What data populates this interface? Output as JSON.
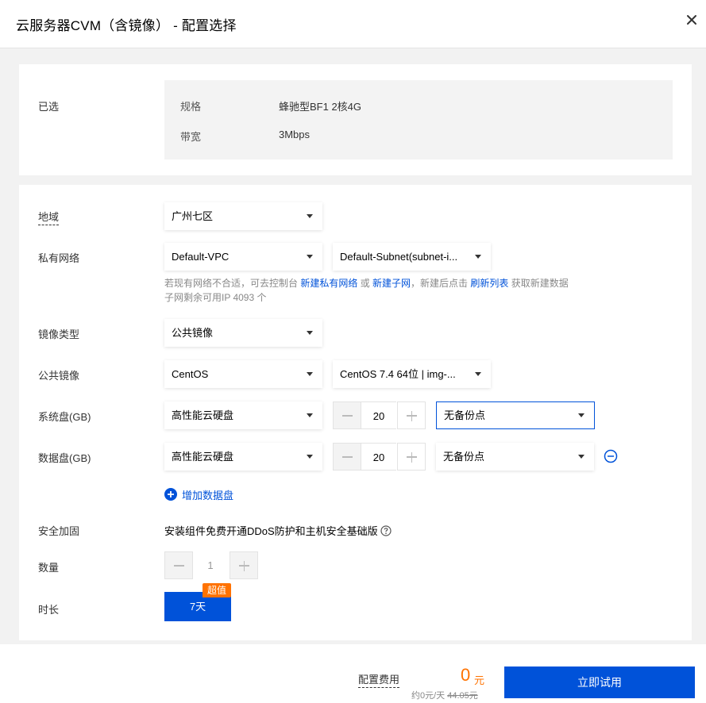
{
  "header": {
    "title": "云服务器CVM（含镜像） - 配置选择"
  },
  "selected": {
    "label": "已选",
    "items": [
      {
        "key": "规格",
        "value": "蜂驰型BF1 2核4G"
      },
      {
        "key": "带宽",
        "value": "3Mbps"
      }
    ]
  },
  "form": {
    "region": {
      "label": "地域",
      "value": "广州七区"
    },
    "network": {
      "label": "私有网络",
      "vpc": "Default-VPC",
      "subnet": "Default-Subnet(subnet-i...",
      "hint_pre": "若现有网络不合适，可去控制台 ",
      "hint_link1": "新建私有网络",
      "hint_mid1": " 或 ",
      "hint_link2": "新建子网",
      "hint_mid2": "，新建后点击 ",
      "hint_link3": "刷新列表",
      "hint_post": " 获取新建数据",
      "hint_line2": "子网剩余可用IP 4093 个"
    },
    "image_type": {
      "label": "镜像类型",
      "value": "公共镜像"
    },
    "public_image": {
      "label": "公共镜像",
      "os": "CentOS",
      "version": "CentOS 7.4 64位 | img-..."
    },
    "system_disk": {
      "label": "系统盘(GB)",
      "type": "高性能云硬盘",
      "size": "20",
      "backup": "无备份点"
    },
    "data_disk": {
      "label": "数据盘(GB)",
      "type": "高性能云硬盘",
      "size": "20",
      "backup": "无备份点"
    },
    "add_data_disk": "增加数据盘",
    "security": {
      "label": "安全加固",
      "text": "安装组件免费开通DDoS防护和主机安全基础版"
    },
    "quantity": {
      "label": "数量",
      "value": "1"
    },
    "duration": {
      "label": "时长",
      "value": "7天",
      "badge": "超值"
    }
  },
  "footer": {
    "fee_label": "配置费用",
    "price": "0",
    "price_unit": "元",
    "price_sub_prefix": "约0元/天 ",
    "original_price": "44.05元",
    "cta": "立即试用"
  },
  "colors": {
    "primary": "#0052d9",
    "accent": "#ff7200"
  }
}
